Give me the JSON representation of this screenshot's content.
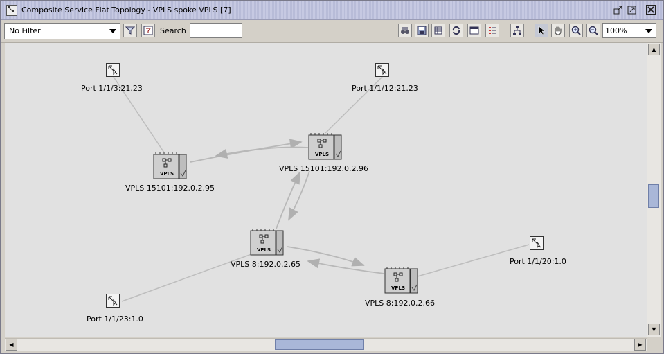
{
  "window": {
    "title": "Composite Service Flat Topology - VPLS spoke VPLS [7]"
  },
  "toolbar": {
    "filter_value": "No Filter",
    "search_label": "Search",
    "search_value": "",
    "zoom_value": "100%"
  },
  "topology": {
    "ports": [
      {
        "label": "Port 1/1/3:21.23"
      },
      {
        "label": "Port 1/1/12:21.23"
      },
      {
        "label": "Port 1/1/20:1.0"
      },
      {
        "label": "Port 1/1/23:1.0"
      }
    ],
    "vpls": [
      {
        "label": "VPLS 15101:192.0.2.95",
        "icon_text": "VPLS"
      },
      {
        "label": "VPLS 15101:192.0.2.96",
        "icon_text": "VPLS"
      },
      {
        "label": "VPLS 8:192.0.2.65",
        "icon_text": "VPLS"
      },
      {
        "label": "VPLS 8:192.0.2.66",
        "icon_text": "VPLS"
      }
    ]
  },
  "colors": {
    "titlebar": "#c2c5df",
    "canvas": "#e1e1e1",
    "link": "#b9b9b9",
    "scroll_thumb": "#a9b7d8"
  }
}
